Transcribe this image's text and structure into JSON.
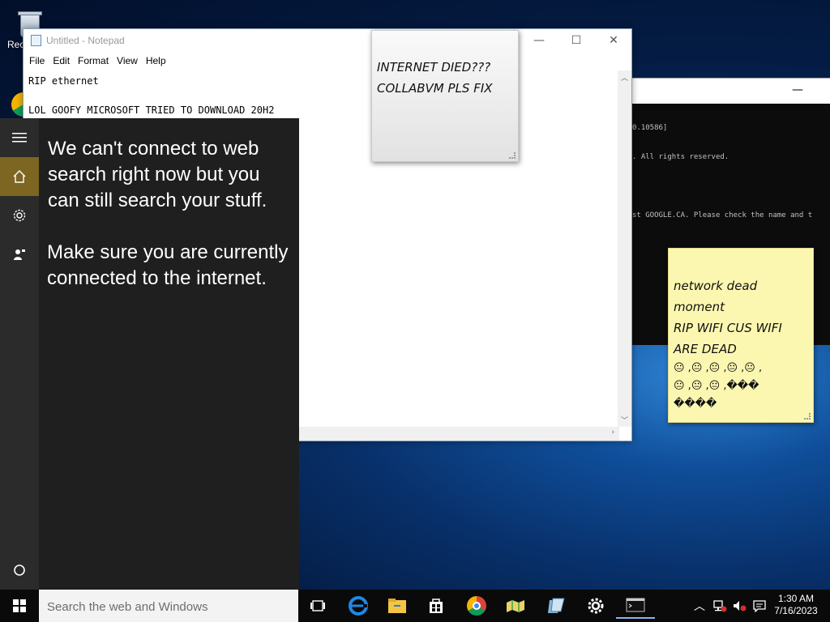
{
  "desktop": {
    "icons": [
      {
        "label": "Rec"
      }
    ]
  },
  "cmd": {
    "lines": [
      "0.10586]",
      ". All rights reserved.",
      "",
      "st GOOGLE.CA. Please check the name and t"
    ]
  },
  "notepad": {
    "title": "Untitled - Notepad",
    "menu": [
      "File",
      "Edit",
      "Format",
      "View",
      "Help"
    ],
    "content": "RIP ethernet\n\nLOL GOOFY MICROSOFT TRIED TO DOWNLOAD 20H2",
    "controls": {
      "minimize": "—",
      "maximize": "☐",
      "close": "✕"
    }
  },
  "sticky_notes": [
    {
      "lines": [
        "INTERNET DIED???",
        "COLLABVM PLS FIX"
      ],
      "color": "#f0f0f0"
    },
    {
      "lines": [
        "network dead",
        "moment",
        "RIP WIFI CUS WIFI",
        "ARE DEAD",
        "😐 ,😐 ,😐 ,😐 ,😐 ,",
        "😐 ,😐 ,😐 ,���",
        "����"
      ],
      "color": "#fcf7b0"
    }
  ],
  "search_panel": {
    "message1": "We can't connect to web search right now but you can still search your stuff.",
    "message2": "Make sure you are currently connected to the internet.",
    "accent": "#7d6522"
  },
  "taskbar": {
    "search_placeholder": "Search the web and Windows",
    "clock_time": "1:30 AM",
    "clock_date": "7/16/2023"
  }
}
